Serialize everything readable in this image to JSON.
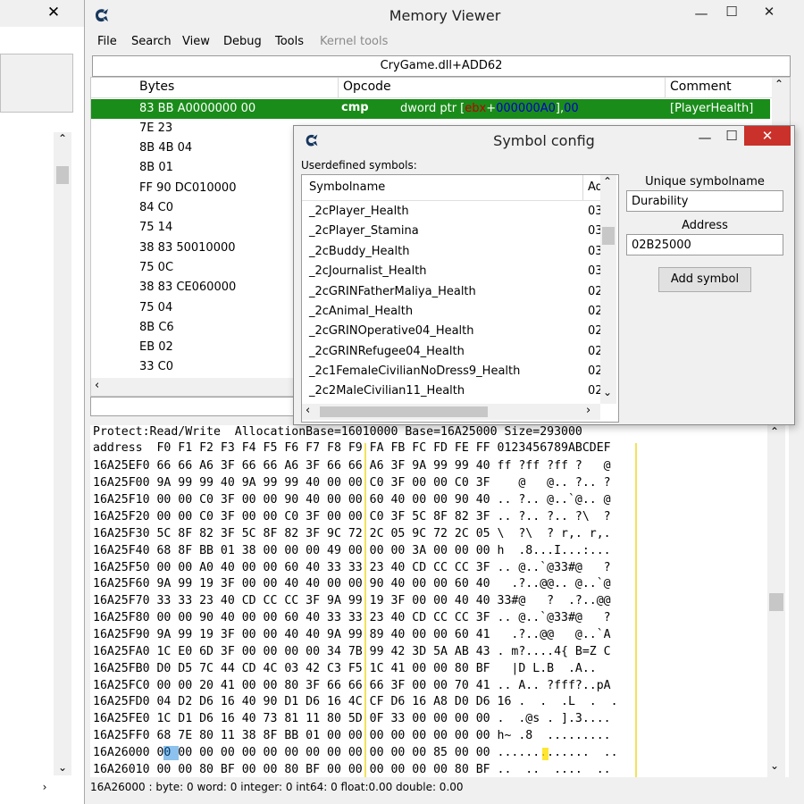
{
  "left_window": {
    "close_glyph": "✕"
  },
  "memory_viewer": {
    "title": "Memory Viewer",
    "window_buttons": {
      "minimize": "—",
      "maximize": "☐",
      "close": "✕"
    },
    "menu": [
      "File",
      "Search",
      "View",
      "Debug",
      "Tools",
      "Kernel tools"
    ],
    "address_bar": "CryGame.dll+ADD62",
    "disasm": {
      "columns": [
        "Bytes",
        "Opcode",
        "Comment"
      ],
      "selected": {
        "bytes": "83 BB A0000000 00",
        "opcode": "cmp",
        "args_prefix": "dword ptr [",
        "args_reg": "ebx",
        "args_plus": "+",
        "args_offset": "000000A0",
        "args_close": "],",
        "args_imm": "00",
        "comment": "[PlayerHealth]"
      },
      "rows": [
        "7E 23",
        "8B 4B 04",
        "8B 01",
        "FF 90 DC010000",
        "84 C0",
        "75 14",
        "38 83 50010000",
        "75 0C",
        "38 83 CE060000",
        "75 04",
        "8B C6",
        "EB 02",
        "33 C0"
      ]
    },
    "hex": {
      "info_line": "Protect:Read/Write  AllocationBase=16010000 Base=16A25000 Size=293000",
      "header": "address  F0 F1 F2 F3 F4 F5 F6 F7 F8 F9 FA FB FC FD FE FF 0123456789ABCDEF",
      "lines": [
        "16A25EF0 66 66 A6 3F 66 66 A6 3F 66 66 A6 3F 9A 99 99 40 ff ?ff ?ff ?   @",
        "16A25F00 9A 99 99 40 9A 99 99 40 00 00 C0 3F 00 00 C0 3F    @   @.. ?.. ?",
        "16A25F10 00 00 C0 3F 00 00 90 40 00 00 60 40 00 00 90 40 .. ?.. @..`@.. @",
        "16A25F20 00 00 C0 3F 00 00 C0 3F 00 00 C0 3F 5C 8F 82 3F .. ?.. ?.. ?\\  ?",
        "16A25F30 5C 8F 82 3F 5C 8F 82 3F 9C 72 2C 05 9C 72 2C 05 \\  ?\\  ? r,. r,.",
        "16A25F40 68 8F BB 01 38 00 00 00 49 00 00 00 3A 00 00 00 h  .8...I...:...",
        "16A25F50 00 00 A0 40 00 00 60 40 33 33 23 40 CD CC CC 3F .. @..`@33#@   ?",
        "16A25F60 9A 99 19 3F 00 00 40 40 00 00 90 40 00 00 60 40   .?..@@.. @..`@",
        "16A25F70 33 33 23 40 CD CC CC 3F 9A 99 19 3F 00 00 40 40 33#@   ?  .?..@@",
        "16A25F80 00 00 90 40 00 00 60 40 33 33 23 40 CD CC CC 3F .. @..`@33#@   ?",
        "16A25F90 9A 99 19 3F 00 00 40 40 9A 99 89 40 00 00 60 41   .?..@@   @..`A",
        "16A25FA0 1C E0 6D 3F 00 00 00 00 34 7B 99 42 3D 5A AB 43 . m?....4{ B=Z C",
        "16A25FB0 D0 D5 7C 44 CD 4C 03 42 C3 F5 1C 41 00 00 80 BF   |D L.B  .A..  ",
        "16A25FC0 00 00 20 41 00 00 80 3F 66 66 66 3F 00 00 70 41 .. A.. ?fff?..pA",
        "16A25FD0 04 D2 D6 16 40 90 D1 D6 16 4C CF D6 16 A8 D0 D6 16 .  .  .L  .  .",
        "16A25FE0 1C D1 D6 16 40 73 81 11 80 5D 0F 33 00 00 00 00 .  .@s . ].3....",
        "16A25FF0 68 7E 80 11 38 8F BB 01 00 00 00 00 00 00 00 00 h~ .8  .........",
        "16A26000 00 00 00 00 00 00 00 00 00 00 00 00 00 85 00 00 .............  ..",
        "16A26010 00 00 80 BF 00 00 80 BF 00 00 00 00 00 00 80 BF ..  ..  ....  .."
      ]
    },
    "status": "16A26000 : byte: 0 word: 0 integer: 0 int64: 0 float:0.00 double: 0.00"
  },
  "symbol_config": {
    "title": "Symbol config",
    "window_buttons": {
      "minimize": "—",
      "maximize": "☐",
      "close": "✕"
    },
    "userdefined_label": "Userdefined symbols:",
    "columns": [
      "Symbolname",
      "Ad"
    ],
    "symbols": [
      {
        "name": "_2cPlayer_Health",
        "addr": "03"
      },
      {
        "name": "_2cPlayer_Stamina",
        "addr": "03"
      },
      {
        "name": "_2cBuddy_Health",
        "addr": "03"
      },
      {
        "name": "_2cJournalist_Health",
        "addr": "03"
      },
      {
        "name": "_2cGRINFatherMaliya_Health",
        "addr": "02"
      },
      {
        "name": "_2cAnimal_Health",
        "addr": "02"
      },
      {
        "name": "_2cGRINOperative04_Health",
        "addr": "02"
      },
      {
        "name": "_2cGRINRefugee04_Health",
        "addr": "02"
      },
      {
        "name": "_2c1FemaleCivilianNoDress9_Health",
        "addr": "02"
      },
      {
        "name": "_2c2MaleCivilian11_Health",
        "addr": "02"
      }
    ],
    "unique_symbolname_label": "Unique symbolname",
    "unique_symbolname_value": "Durability",
    "address_label": "Address",
    "address_value": "02B25000",
    "add_symbol_button": "Add symbol"
  }
}
